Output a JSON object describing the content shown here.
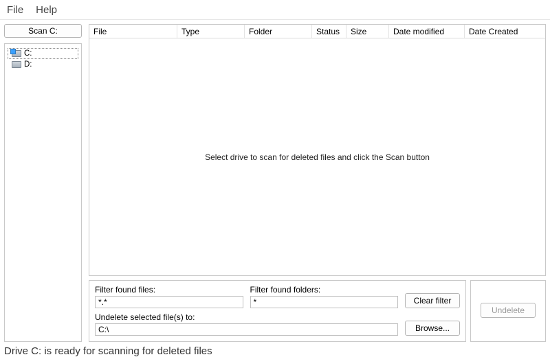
{
  "menu": {
    "file": "File",
    "help": "Help"
  },
  "scan_button": "Scan C:",
  "drives": [
    {
      "label": "C:",
      "selected": true
    },
    {
      "label": "D:",
      "selected": false
    }
  ],
  "columns": {
    "file": "File",
    "type": "Type",
    "folder": "Folder",
    "status": "Status",
    "size": "Size",
    "date_modified": "Date modified",
    "date_created": "Date Created"
  },
  "placeholder_message": "Select drive to scan for deleted files and click the Scan button",
  "filters": {
    "files_label": "Filter found files:",
    "files_value": "*.*",
    "folders_label": "Filter found folders:",
    "folders_value": "*",
    "clear_button": "Clear filter"
  },
  "undelete": {
    "path_label": "Undelete selected file(s) to:",
    "path_value": "C:\\",
    "browse_button": "Browse...",
    "undelete_button": "Undelete"
  },
  "status_text": "Drive C: is ready for scanning for deleted files"
}
